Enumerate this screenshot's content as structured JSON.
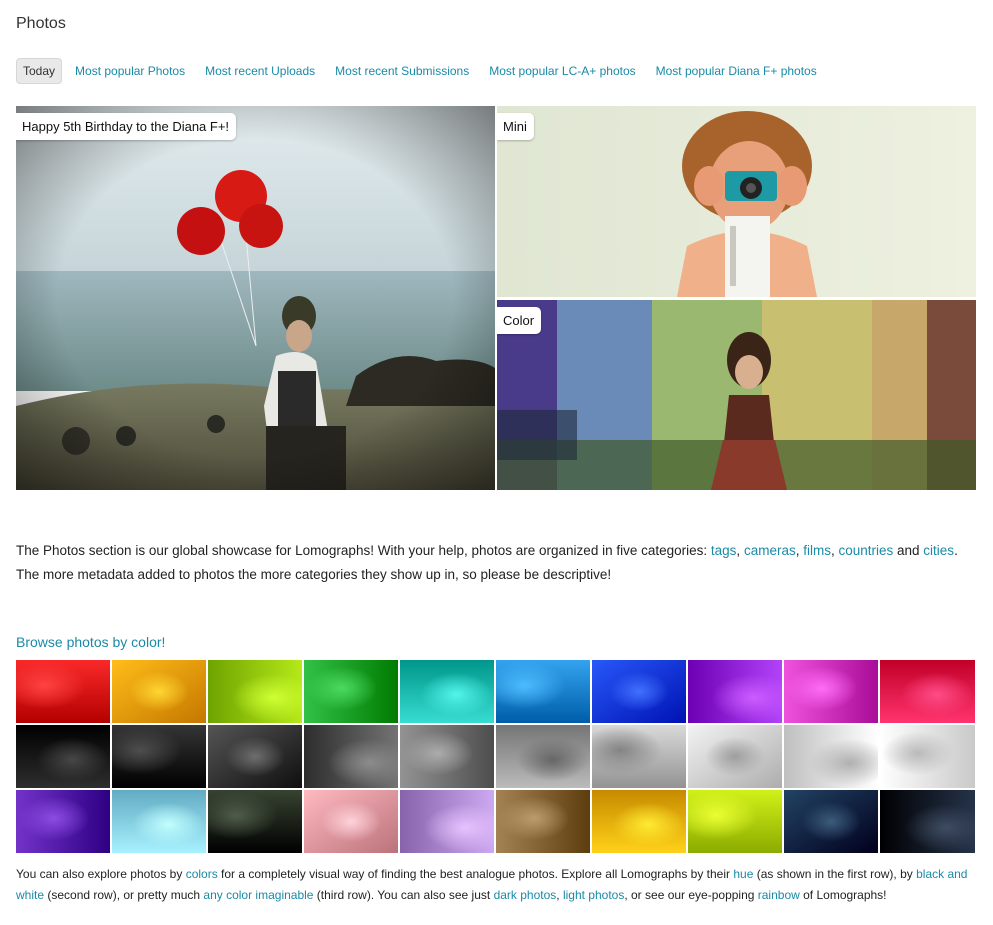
{
  "page": {
    "title": "Photos"
  },
  "tabs": [
    {
      "label": "Today",
      "active": true
    },
    {
      "label": "Most popular Photos",
      "active": false
    },
    {
      "label": "Most recent Uploads",
      "active": false
    },
    {
      "label": "Most recent Submissions",
      "active": false
    },
    {
      "label": "Most popular LC-A+ photos",
      "active": false
    },
    {
      "label": "Most popular Diana F+ photos",
      "active": false
    }
  ],
  "hero": {
    "big_label": "Happy 5th Birthday to the Diana F+!",
    "mini_label": "Mini",
    "color_label": "Color"
  },
  "description": {
    "text_1": "The Photos section is our global showcase for Lomographs! With your help, photos are organized in five categories: ",
    "link_tags": "tags",
    "sep_1": ", ",
    "link_cameras": "cameras",
    "sep_2": ", ",
    "link_films": "films",
    "sep_3": ", ",
    "link_countries": "countries",
    "text_and": " and ",
    "link_cities": "cities",
    "text_2": ". The more metadata added to photos the more categories they show up in, so please be descriptive!"
  },
  "browse": {
    "label": "Browse photos by color!"
  },
  "colors": {
    "row1": [
      "#e11010",
      "#f2a400",
      "#9cd000",
      "#1aa82e",
      "#1fc3b8",
      "#1b8ad6",
      "#0f3fe0",
      "#9a2ae0",
      "#d63ac4",
      "#ee1a55"
    ],
    "row2": [
      "#151515",
      "#1c1c1c",
      "#3c3c3c",
      "#5a5a5a",
      "#7a7a7a",
      "#a2a2a2",
      "#c0c0c0",
      "#dadada",
      "#ececec",
      "#f6f6f6"
    ],
    "row3": [
      "#5a1ab0",
      "#8fd8f0",
      "#1e2a18",
      "#e8a0a8",
      "#b490d8",
      "#8a6a3a",
      "#f3b800",
      "#b8d800",
      "#0a2a4a",
      "#0c1a30"
    ]
  },
  "footer": {
    "t1": "You can also explore photos by ",
    "l_colors": "colors",
    "t2": " for a completely visual way of finding the best analogue photos. Explore all Lomographs by their ",
    "l_hue": "hue",
    "t3": " (as shown in the first row), by ",
    "l_bw": "black and white",
    "t4": " (second row), or pretty much ",
    "l_any": "any color imaginable",
    "t5": " (third row). You can also see just ",
    "l_dark": "dark photos",
    "t6": ", ",
    "l_light": "light photos",
    "t7": ", or see our eye-popping ",
    "l_rainbow": "rainbow",
    "t8": " of Lomographs!"
  }
}
